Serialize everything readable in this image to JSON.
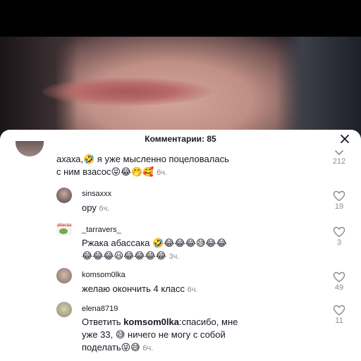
{
  "header": {
    "title": "Комментарии: 85"
  },
  "comments": [
    {
      "username": "",
      "text": "ахаха,🤣 я уже мысленно поцеловалась",
      "text2": "с ним взасос",
      "emojis": "😝😂🤭🥰",
      "time": "6ч.",
      "likes": "212"
    },
    {
      "username": "sinsaxxx",
      "text": "ору",
      "time": "6ч.",
      "likes": "19"
    },
    {
      "username": "_tarravers_",
      "text": "Ржака абассака",
      "emojis1": "🤣😂😂😂😅😂😂",
      "emojis2": "😂😂😂😃😂😂😂😂",
      "time": "3ч.",
      "likes": "3"
    },
    {
      "username": "komsom0lka",
      "text": "желаю окончить 4 класс",
      "time": "6ч.",
      "likes": "49"
    },
    {
      "username": "elena8719",
      "prefix": "Ответить",
      "mention": "komsom0lka",
      "text": ":спасибо, мне",
      "text2": "уже 33, 😅 ничего не могу с собой",
      "text3": "поделать",
      "emojis": "😝😅",
      "time": "6ч.",
      "likes": "11"
    }
  ],
  "colors": {
    "text": "#161823",
    "muted": "#8a8b91",
    "background": "#ffffff"
  }
}
